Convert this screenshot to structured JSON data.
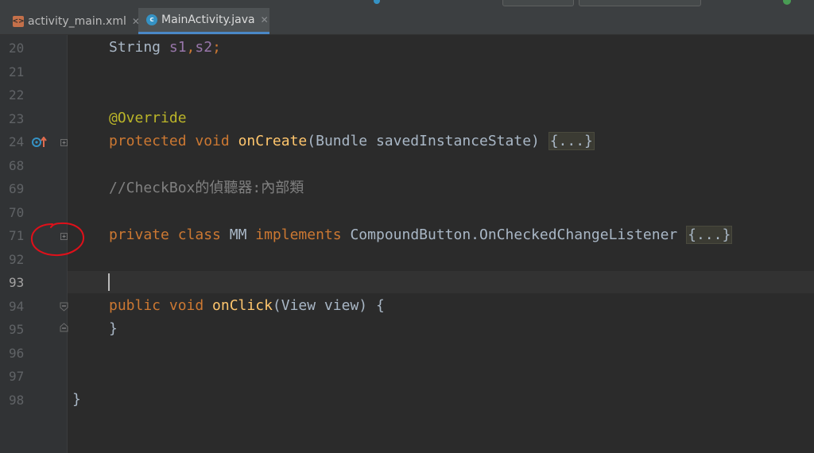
{
  "tabs": [
    {
      "label": "activity_main.xml",
      "icon": "xml-file-icon",
      "active": false
    },
    {
      "label": "MainActivity.java",
      "icon": "java-class-icon",
      "active": true
    }
  ],
  "editor": {
    "current_line": "93",
    "lines": [
      {
        "num": "20"
      },
      {
        "num": "21"
      },
      {
        "num": "22"
      },
      {
        "num": "23"
      },
      {
        "num": "24"
      },
      {
        "num": "68"
      },
      {
        "num": "69"
      },
      {
        "num": "70"
      },
      {
        "num": "71"
      },
      {
        "num": "92"
      },
      {
        "num": "93"
      },
      {
        "num": "94"
      },
      {
        "num": "95"
      },
      {
        "num": "96"
      },
      {
        "num": "97"
      },
      {
        "num": "98"
      }
    ],
    "code": {
      "l20": {
        "t1": "String ",
        "t2": "s1",
        "t3": ",",
        "t4": "s2",
        "t5": ";"
      },
      "l23": {
        "t1": "@Override"
      },
      "l24": {
        "t1": "protected ",
        "t2": "void ",
        "t3": "onCreate",
        "t4": "(Bundle savedInstanceState) ",
        "t5": "{...}"
      },
      "l69": {
        "t1": "//CheckBox的偵聽器:內部類"
      },
      "l71": {
        "t1": "private ",
        "t2": "class ",
        "t3": "MM ",
        "t4": "implements ",
        "t5": "CompoundButton.OnCheckedChangeListener ",
        "t6": "{...}"
      },
      "l94": {
        "t1": "public ",
        "t2": "void ",
        "t3": "onClick",
        "t4": "(View view) {"
      },
      "l95": {
        "t1": "}"
      },
      "l98": {
        "t1": "}"
      }
    }
  },
  "colors": {
    "background": "#2b2b2b",
    "keyword": "#cc7832",
    "method": "#ffc66d",
    "field": "#9876aa",
    "annotation": "#bbb529",
    "comment": "#808080",
    "annotation_circle": "#e0101a"
  }
}
